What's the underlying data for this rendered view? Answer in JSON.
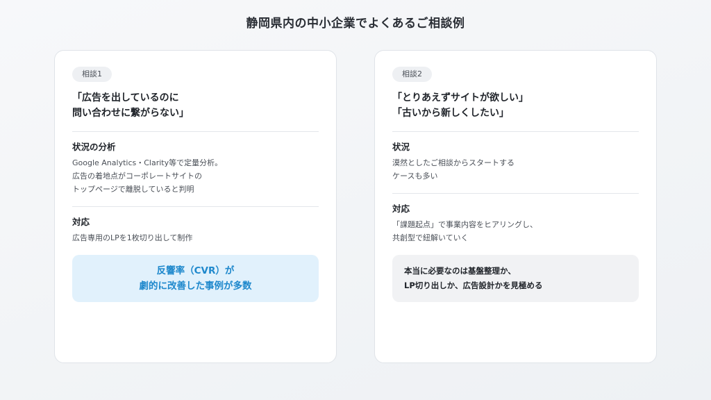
{
  "page_title": "静岡県内の中小企業でよくあるご相談例",
  "cards": [
    {
      "badge": "相談1",
      "headline": [
        "「広告を出しているのに",
        "問い合わせに繋がらない」"
      ],
      "section1": {
        "title": "状況の分析",
        "lines": [
          "Google Analytics・Clarity等で定量分析。",
          "広告の着地点がコーポレートサイトの",
          "トップページで離脱していると判明"
        ]
      },
      "section2": {
        "title": "対応",
        "lines": [
          "広告専用のLPを1枚切り出して制作"
        ]
      },
      "highlight": [
        "反響率（CVR）が",
        "劇的に改善した事例が多数"
      ]
    },
    {
      "badge": "相談2",
      "headline": [
        "「とりあえずサイトが欲しい」",
        "「古いから新しくしたい」"
      ],
      "section1": {
        "title": "状況",
        "lines": [
          "漠然としたご相談からスタートする",
          "ケースも多い"
        ]
      },
      "section2": {
        "title": "対応",
        "lines": [
          "「課題起点」で事業内容をヒアリングし、",
          "共創型で紐解いていく"
        ]
      },
      "highlight": [
        "本当に必要なのは基盤整理か、",
        "LP切り出しか、広告設計かを見極める"
      ]
    }
  ]
}
